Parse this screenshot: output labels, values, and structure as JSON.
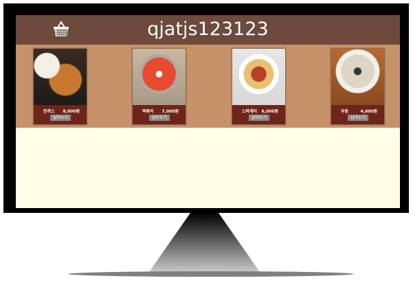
{
  "header": {
    "title": "qjatjs123123",
    "cart_icon": "shopping-basket-icon"
  },
  "colors": {
    "header": "#6d4a3c",
    "band": "#c7926a",
    "content": "#fffde6",
    "card": "#6e2418",
    "button": "#888888"
  },
  "products": [
    {
      "name": "돈까스",
      "price": "8,000원",
      "button": "담아두기"
    },
    {
      "name": "떡볶이",
      "price": "7,000원",
      "button": "담아두기"
    },
    {
      "name": "스파게티",
      "price": "6,000원",
      "button": "담아두기"
    },
    {
      "name": "우동",
      "price": "4,000원",
      "button": "담아두기"
    }
  ]
}
